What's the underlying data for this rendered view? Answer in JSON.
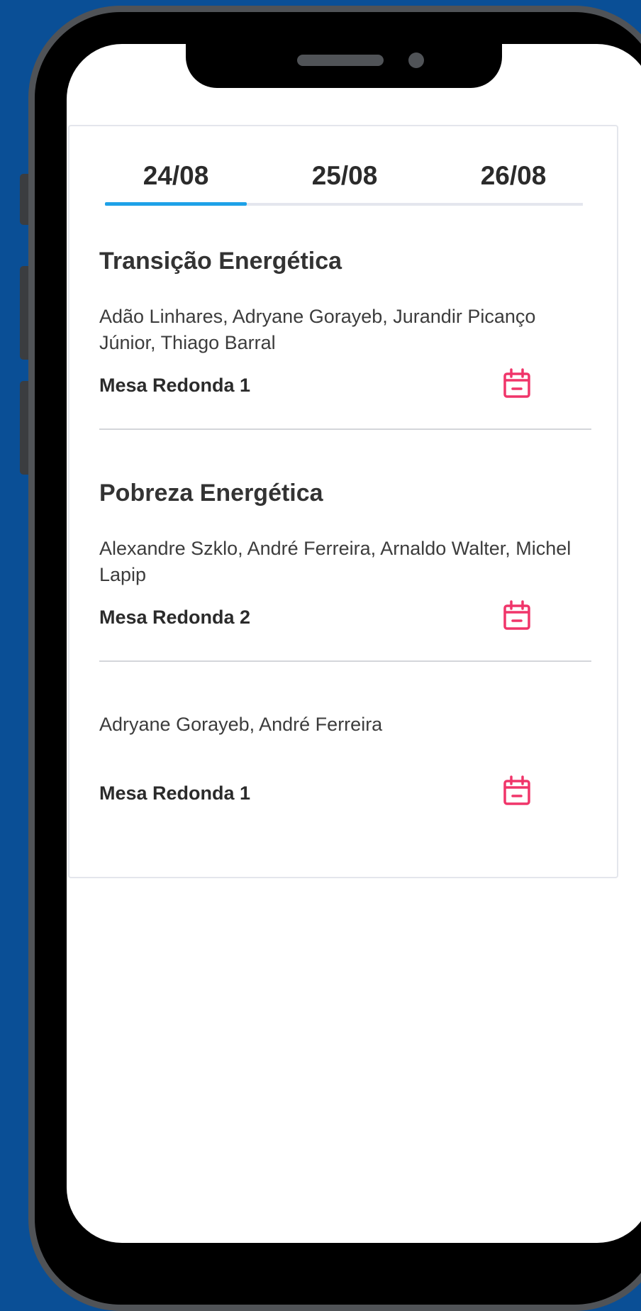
{
  "tabs": [
    {
      "label": "24/08",
      "active": true
    },
    {
      "label": "25/08",
      "active": false
    },
    {
      "label": "26/08",
      "active": false
    }
  ],
  "sessions": [
    {
      "title": "Transição Energética",
      "speakers": "Adão Linhares, Adryane Gorayeb, Jurandir Picanço Júnior, Thiago Barral",
      "type": "Mesa Redonda 1",
      "icon": "calendar-icon"
    },
    {
      "title": "Pobreza Energética",
      "speakers": "Alexandre Szklo, André Ferreira, Arnaldo Walter, Michel Lapip",
      "type": "Mesa Redonda 2",
      "icon": "calendar-icon"
    },
    {
      "title": "",
      "speakers": "Adryane Gorayeb, André Ferreira",
      "type": "Mesa Redonda 1",
      "icon": "calendar-icon"
    }
  ],
  "colors": {
    "background": "#0a4f96",
    "tab_active_underline": "#1ea1e8",
    "calendar_icon": "#f0356a"
  }
}
